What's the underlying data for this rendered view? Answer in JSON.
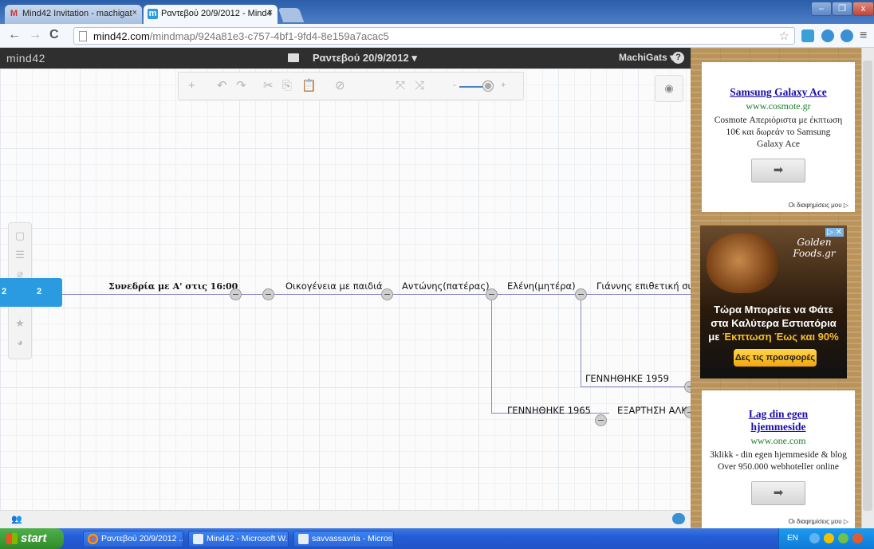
{
  "browser": {
    "tabs": [
      {
        "title": "Mind42 Invitation - machigat",
        "icon": "gmail-icon",
        "active": false
      },
      {
        "title": "Ραντεβού 20/9/2012 - Mind4",
        "icon": "mind42-icon",
        "active": true
      }
    ],
    "tab_close": "×",
    "url_host": "mind42.com",
    "url_path": "/mindmap/924a81e3-c757-4bf1-9fd4-8e159a7acac5",
    "window_controls": [
      "–",
      "❐",
      "x"
    ]
  },
  "app": {
    "logo": "mind42",
    "map_title": "Ραντεβού 20/9/2012 ▾",
    "user_menu": "MachiGats ▾",
    "help": "?"
  },
  "toolbar": {
    "zoom_minus": "-",
    "zoom_plus": "+",
    "zoom_level": 0.9
  },
  "mindmap": {
    "root_label": "2",
    "root_left_label": "2",
    "nodes": {
      "session": "Συνεδρία με Α' στις 16:00",
      "family": "Οικογένεια με παιδιά",
      "antonis": "Αντώνης(πατέρας)",
      "eleni": "Ελένη(μητέρα)",
      "giannis": "Γιάννης επιθετική συμπε",
      "born1959": "ΓΕΝΝΗΘΗΚΕ 1959",
      "born1965": "ΓΕΝΝΗΘΗΚΕ 1965",
      "addiction": "ΕΞΑΡΤΗΣΗ ΑΛΚΟ"
    }
  },
  "ads": {
    "ad1": {
      "title": "Samsung Galaxy Ace",
      "url": "www.cosmote.gr",
      "text": "Cosmote Απεριόριστα με έκπτωση 10€ και δωρεάν το Samsung Galaxy Ace",
      "button": "➡",
      "choices": "Οι διαφημίσεις μου ▷"
    },
    "ad2": {
      "brand": "Golden Foods.gr",
      "line1": "Τώρα Μπορείτε να Φάτε",
      "line2": "στα Καλύτερα Εστιατόρια",
      "line3_prefix": "με ",
      "line3_highlight": "Έκπτωση Έως και 90%",
      "button": "Δες τις προσφορές",
      "close": "▷ ✕"
    },
    "ad3": {
      "title": "Lag din egen hjemmeside",
      "url": "www.one.com",
      "text": "3klikk - din egen hjemmeside & blog Over 950.000 webhoteller online",
      "button": "➡",
      "choices": "Οι διαφημίσεις μου ▷"
    }
  },
  "taskbar": {
    "start": "start",
    "tasks": [
      {
        "label": "Ραντεβού 20/9/2012 ...",
        "icon": "chrome-icon"
      },
      {
        "label": "Mind42 - Microsoft W...",
        "icon": "word-icon"
      },
      {
        "label": "savvassavria - Micros...",
        "icon": "word-icon"
      }
    ],
    "language": "EN"
  },
  "colors": {
    "accent": "#2a9be0",
    "edge": "#8a87c4",
    "header": "#2f2f2f"
  }
}
